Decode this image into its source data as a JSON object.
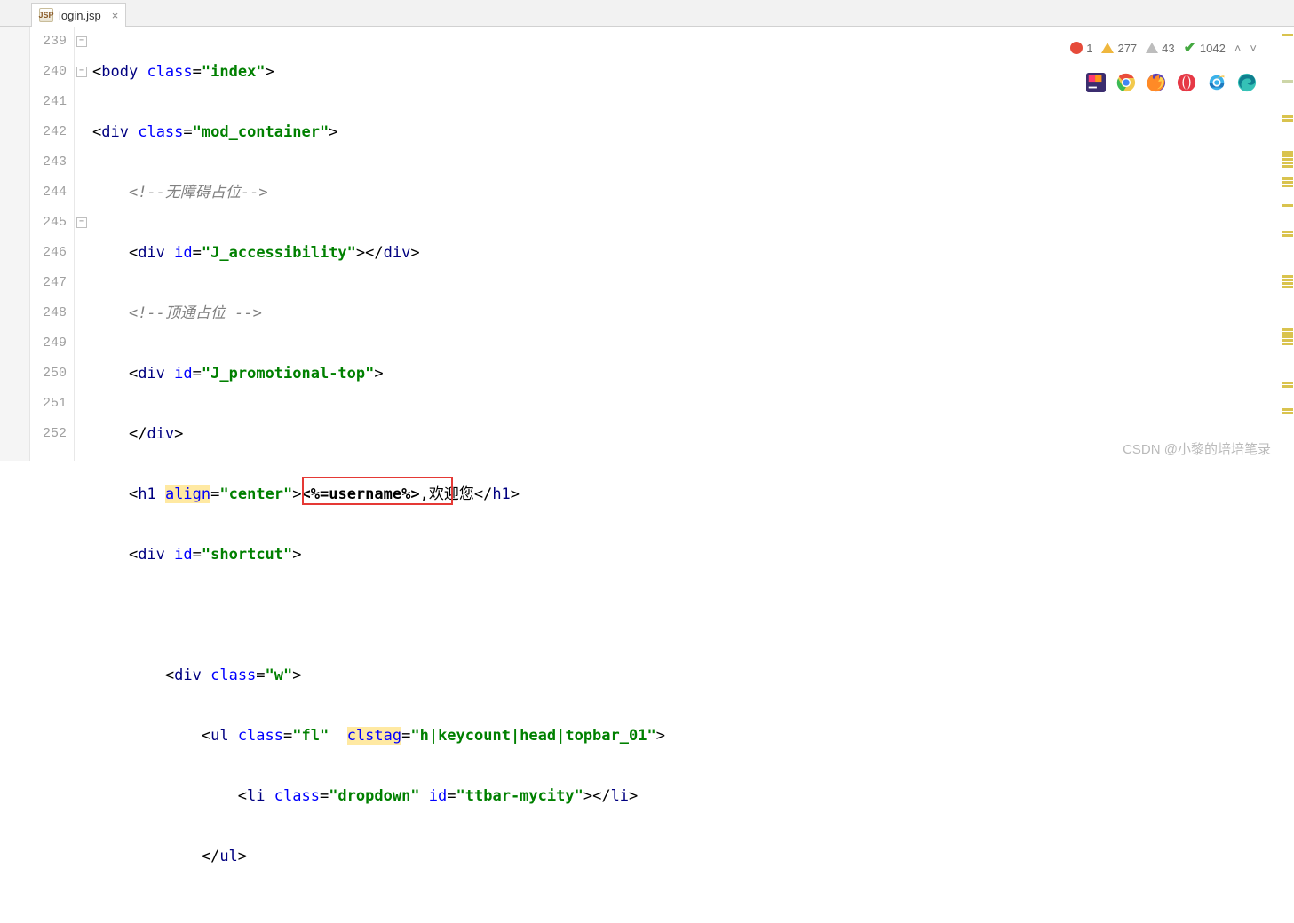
{
  "tab": {
    "label": "login.jsp",
    "icon": "JSP"
  },
  "inspections": {
    "error_count": "1",
    "warning_count": "277",
    "weak_count": "43",
    "info_count": "1042"
  },
  "browsers": [
    "jetbrains",
    "chrome",
    "firefox",
    "opera",
    "ie",
    "edge"
  ],
  "gutter": [
    "239",
    "240",
    "241",
    "242",
    "243",
    "244",
    "245",
    "246",
    "247",
    "248",
    "249",
    "250",
    "251",
    "252"
  ],
  "code": {
    "l239": {
      "open": "<",
      "tag": "body",
      "sp": " ",
      "attr": "class",
      "eq": "=",
      "val": "\"index\"",
      "close": ">"
    },
    "l240": {
      "open": "<",
      "tag": "div",
      "sp": " ",
      "attr": "class",
      "eq": "=",
      "val": "\"mod_container\"",
      "close": ">"
    },
    "l241": {
      "comment": "<!--无障碍占位-->"
    },
    "l242": {
      "open": "<",
      "tag": "div",
      "sp": " ",
      "attr": "id",
      "eq": "=",
      "val": "\"J_accessibility\"",
      "close": ">",
      "ctag": "div"
    },
    "l243": {
      "comment": "<!--顶通占位 -->"
    },
    "l244": {
      "open": "<",
      "tag": "div",
      "sp": " ",
      "attr": "id",
      "eq": "=",
      "val": "\"J_promotional-top\"",
      "close": ">"
    },
    "l245": {
      "ctag": "div"
    },
    "l246": {
      "open": "<",
      "tag": "h1",
      "sp": " ",
      "attr": "align",
      "eq": "=",
      "val": "\"center\"",
      "close": ">",
      "jsp": "<%=username%>",
      "txt": ",欢迎您",
      "ctag": "h1"
    },
    "l247": {
      "open": "<",
      "tag": "div",
      "sp": " ",
      "attr": "id",
      "eq": "=",
      "val": "\"shortcut\"",
      "close": ">"
    },
    "l249": {
      "open": "<",
      "tag": "div",
      "sp": " ",
      "attr": "class",
      "eq": "=",
      "val": "\"w\"",
      "close": ">"
    },
    "l250": {
      "open": "<",
      "tag": "ul",
      "sp": " ",
      "attr": "class",
      "eq": "=",
      "val": "\"fl\"",
      "sp2": "  ",
      "attr2": "clstag",
      "eq2": "=",
      "val2": "\"h|keycount|head|topbar_01\"",
      "close": ">"
    },
    "l251": {
      "open": "<",
      "tag": "li",
      "sp": " ",
      "attr": "class",
      "eq": "=",
      "val": "\"dropdown\"",
      "sp2": " ",
      "attr2": "id",
      "eq2": "=",
      "val2": "\"ttbar-mycity\"",
      "close": ">",
      "ctag": "li"
    },
    "l252": {
      "ctag": "ul"
    }
  },
  "watermark": "CSDN @小黎的培培笔录"
}
